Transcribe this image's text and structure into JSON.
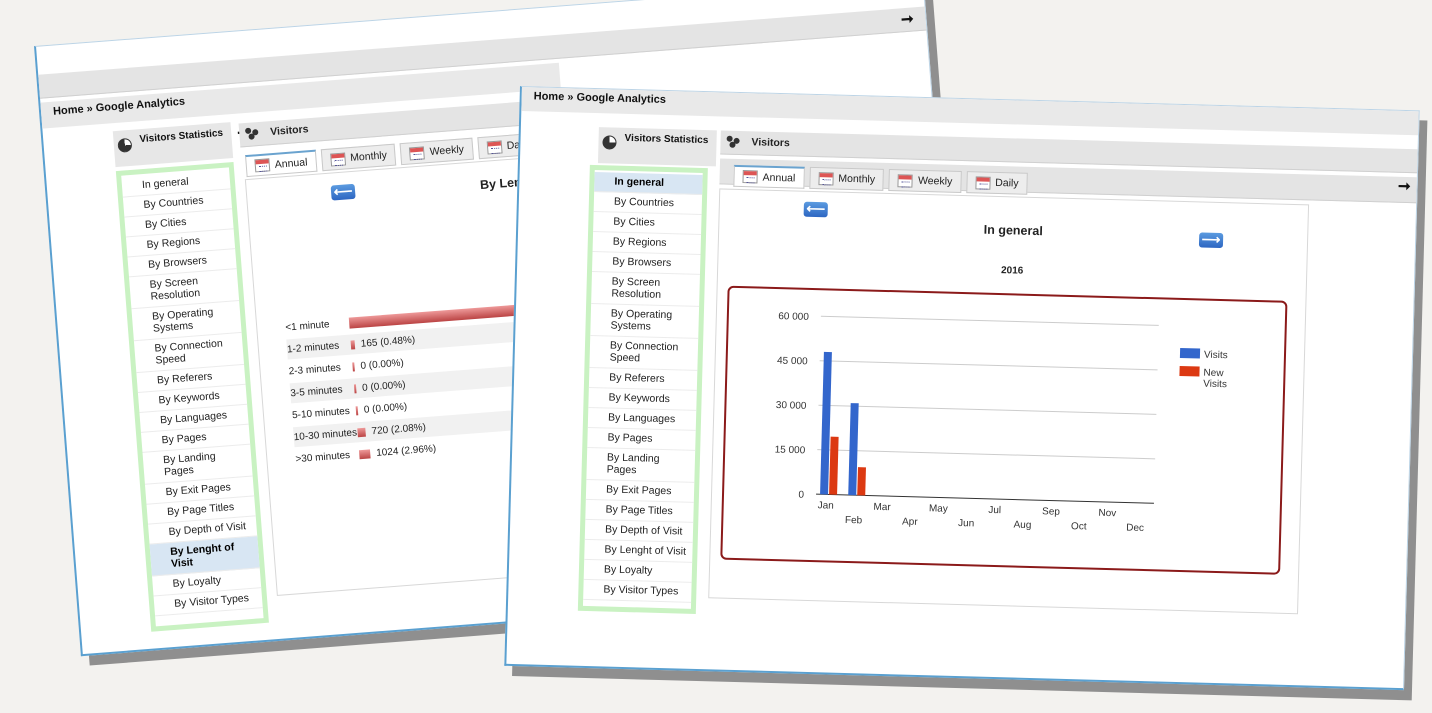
{
  "breadcrumb": {
    "home": "Home",
    "sep": "»",
    "section": "Google Analytics"
  },
  "sidebar": {
    "title": "Visitors Statistics",
    "items": [
      {
        "label": "In general"
      },
      {
        "label": "By Countries"
      },
      {
        "label": "By Cities"
      },
      {
        "label": "By Regions"
      },
      {
        "label": "By Browsers"
      },
      {
        "label": "By Screen Resolution"
      },
      {
        "label": "By Operating Systems"
      },
      {
        "label": "By Connection Speed"
      },
      {
        "label": "By Referers"
      },
      {
        "label": "By Keywords"
      },
      {
        "label": "By Languages"
      },
      {
        "label": "By Pages"
      },
      {
        "label": "By Landing Pages"
      },
      {
        "label": "By Exit Pages"
      },
      {
        "label": "By Page Titles"
      },
      {
        "label": "By Depth of Visit"
      },
      {
        "label": "By Lenght of Visit"
      },
      {
        "label": "By Loyalty"
      },
      {
        "label": "By Visitor Types"
      }
    ]
  },
  "panel": {
    "title": "Visitors"
  },
  "tabs": [
    {
      "label": "Annual"
    },
    {
      "label": "Monthly"
    },
    {
      "label": "Weekly"
    },
    {
      "label": "Daily"
    }
  ],
  "back_window": {
    "active_item": "By Lenght of Visit",
    "report_title": "By Lengh",
    "rows": [
      {
        "label": "<1 minute",
        "value": "",
        "fraction": 1.0
      },
      {
        "label": "1-2 minutes",
        "value": "165 (0.48%)",
        "fraction": 0.16
      },
      {
        "label": "2-3 minutes",
        "value": "0 (0.00%)",
        "fraction": 0.0
      },
      {
        "label": "3-5 minutes",
        "value": "0 (0.00%)",
        "fraction": 0.0
      },
      {
        "label": "5-10 minutes",
        "value": "0 (0.00%)",
        "fraction": 0.0
      },
      {
        "label": "10-30 minutes",
        "value": "720 (2.08%)",
        "fraction": 0.7
      },
      {
        "label": ">30 minutes",
        "value": "1024 (2.96%)",
        "fraction": 1.0
      }
    ]
  },
  "front_window": {
    "active_item": "In general",
    "report_title": "In general",
    "year": "2016"
  },
  "chart_data": {
    "type": "bar",
    "categories": [
      "Jan",
      "Feb",
      "Mar",
      "Apr",
      "May",
      "Jun",
      "Jul",
      "Aug",
      "Sep",
      "Oct",
      "Nov",
      "Dec"
    ],
    "series": [
      {
        "name": "Visits",
        "values": [
          48000,
          31000,
          0,
          0,
          0,
          0,
          0,
          0,
          0,
          0,
          0,
          0
        ],
        "color": "#3366cc"
      },
      {
        "name": "New Visits",
        "values": [
          19500,
          9500,
          0,
          0,
          0,
          0,
          0,
          0,
          0,
          0,
          0,
          0
        ],
        "color": "#dc3912"
      }
    ],
    "yticks": [
      "0",
      "15 000",
      "30 000",
      "45 000",
      "60 000"
    ],
    "ylim": [
      0,
      60000
    ],
    "legend": "right",
    "border_color": "#8b1a1a"
  }
}
